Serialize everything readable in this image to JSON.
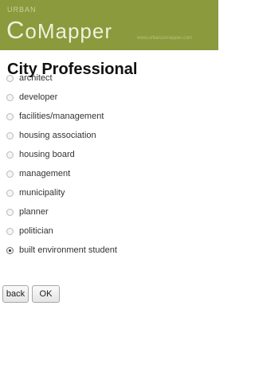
{
  "header": {
    "brand_prefix": "URBAN",
    "brand_first": "C",
    "brand_rest": "oMapper",
    "tagline": "www.urbancomapper.com"
  },
  "page": {
    "title": "City Professional"
  },
  "options": [
    {
      "label": "architect",
      "checked": false
    },
    {
      "label": "developer",
      "checked": false
    },
    {
      "label": "facilities/management",
      "checked": false
    },
    {
      "label": "housing association",
      "checked": false
    },
    {
      "label": "housing board",
      "checked": false
    },
    {
      "label": "management",
      "checked": false
    },
    {
      "label": "municipality",
      "checked": false
    },
    {
      "label": "planner",
      "checked": false
    },
    {
      "label": "politician",
      "checked": false
    },
    {
      "label": "built environment student",
      "checked": true
    }
  ],
  "buttons": {
    "back_label": "back",
    "ok_label": "OK"
  },
  "colors": {
    "header_bg": "#8a9a3c"
  }
}
